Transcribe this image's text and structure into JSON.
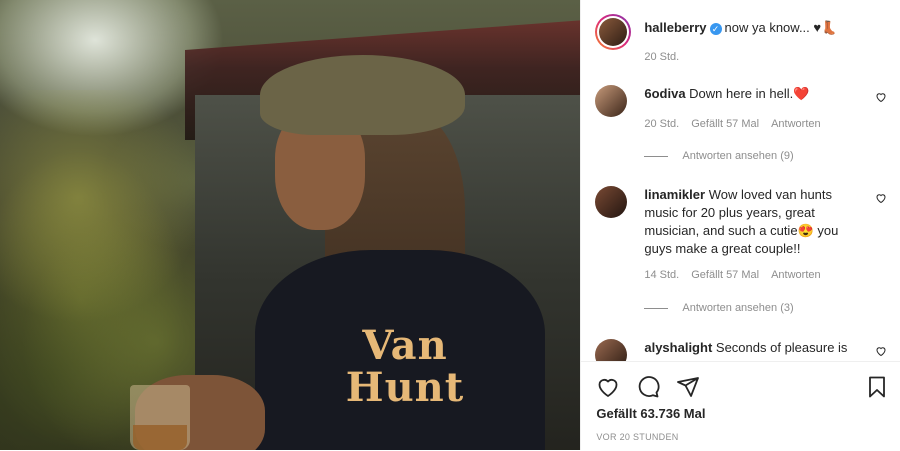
{
  "post": {
    "username": "halleberry",
    "caption": "now ya know... ♥👢",
    "time": "20 Std.",
    "shirt_line1": "Van",
    "shirt_line2": "Hunt"
  },
  "comments": [
    {
      "username": "6odiva",
      "text": "Down here in hell.❤️",
      "time": "20 Std.",
      "likes": "Gefällt 57 Mal",
      "reply": "Antworten",
      "replies": "Antworten ansehen (9)"
    },
    {
      "username": "linamikler",
      "text": "Wow loved van hunts music for 20 plus years, great musician, and such a cutie😍 you guys make a great couple!!",
      "time": "14 Std.",
      "likes": "Gefällt 57 Mal",
      "reply": "Antworten",
      "replies": "Antworten ansehen (3)"
    },
    {
      "username": "alyshalight",
      "text": "Seconds of pleasure is"
    }
  ],
  "actions": {
    "likes": "Gefällt 63.736 Mal",
    "posted": "VOR 20 STUNDEN",
    "icons": [
      "heart-icon",
      "comment-icon",
      "share-icon",
      "bookmark-icon"
    ]
  },
  "colors": {
    "accent": "#3897f0",
    "meta": "#8e8e8e"
  }
}
